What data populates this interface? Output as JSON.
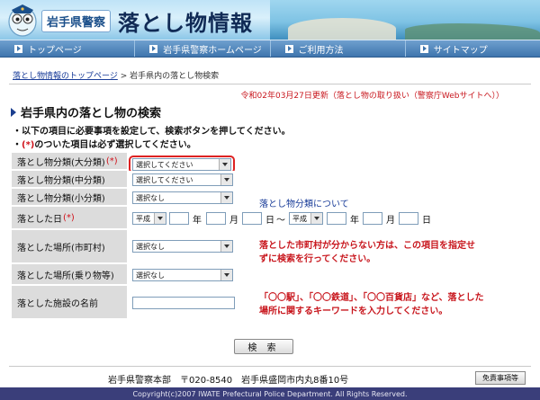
{
  "banner": {
    "police_label": "岩手県警察",
    "title": "落とし物情報"
  },
  "nav": [
    {
      "label": "トップページ"
    },
    {
      "label": "岩手県警察ホームページ"
    },
    {
      "label": "ご利用方法"
    },
    {
      "label": "サイトマップ"
    }
  ],
  "breadcrumb": {
    "link": "落とし物情報のトップページ",
    "separator": " > ",
    "current": "岩手県内の落とし物検索"
  },
  "update_line": "令和02年03月27日更新（落とし物の取り扱い（警察庁Webサイトへ））",
  "section_title": "岩手県内の落とし物の検索",
  "notes": {
    "line1": "・以下の項目に必要事項を設定して、検索ボタンを押してください。",
    "line2_prefix": "・",
    "line2_mark": "(*)",
    "line2_rest": "のついた項目は必ず選択してください。"
  },
  "form": {
    "major": {
      "label": "落とし物分類(大分類)",
      "req": "(*)",
      "value": "選択してください"
    },
    "middle": {
      "label": "落とし物分類(中分類)",
      "value": "選択してください"
    },
    "minor": {
      "label": "落とし物分類(小分類)",
      "value": "選択なし"
    },
    "category_help": "落とし物分類について",
    "date": {
      "label": "落とした日",
      "req": "(*)",
      "era_from": "平成",
      "era_to": "平成",
      "year": "年",
      "month": "月",
      "day": "日",
      "tilde": "～"
    },
    "city": {
      "label": "落とした場所(市町村)",
      "value": "選択なし"
    },
    "city_note_1": "落とした市町村が分からない方は、この項目を指定せ",
    "city_note_2": "ずに検索を行ってください。",
    "vehicle": {
      "label": "落とした場所(乗り物等)",
      "value": "選択なし"
    },
    "facility": {
      "label": "落とした施設の名前",
      "value": ""
    },
    "facility_note_1": "「〇〇駅」、「〇〇鉄道」、「〇〇百貨店」など、落とした",
    "facility_note_2": "場所に関するキーワードを入力してください。"
  },
  "search_button": "検 索",
  "footer": {
    "address": "岩手県警察本部　〒020-8540　岩手県盛岡市内丸8番10号",
    "disclaimer": "免責事項等",
    "copyright": "Copyright(c)2007 IWATE Prefectural Police Department. All Rights Reserved."
  },
  "colors": {
    "nav": "#3f75ad",
    "required": "#d0121b",
    "footer_bar": "#3a3e7a",
    "link": "#1a3d99"
  }
}
